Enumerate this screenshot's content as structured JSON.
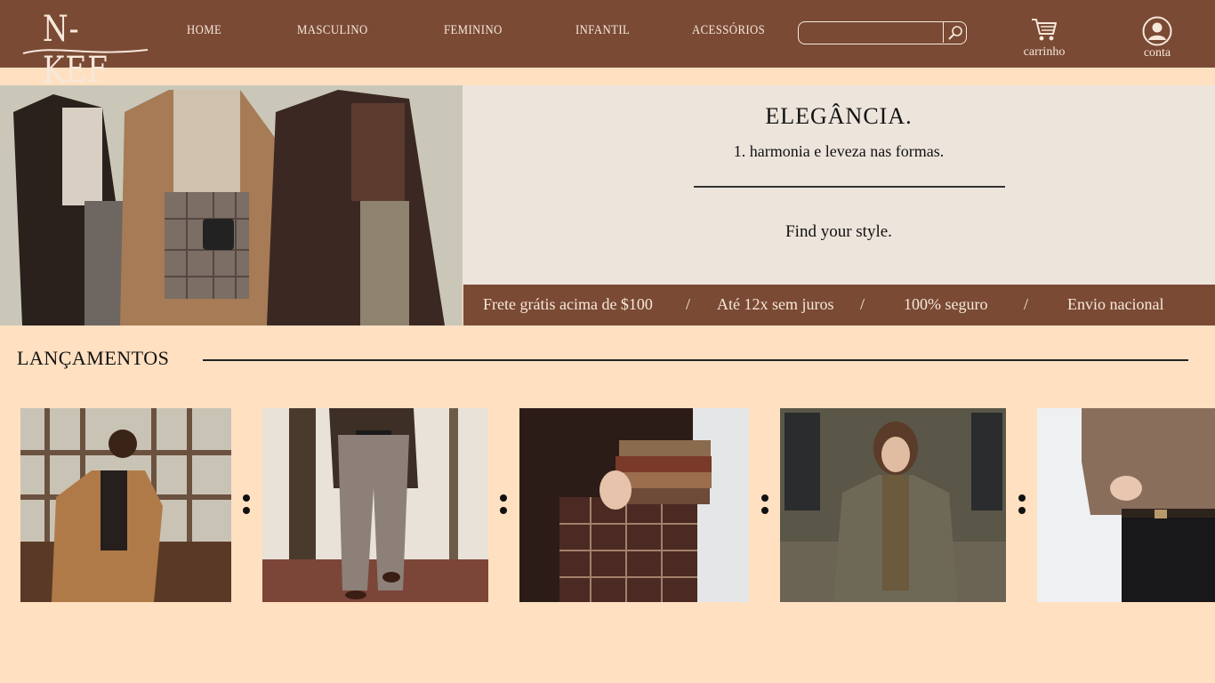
{
  "header": {
    "logo": "N-KEF",
    "nav": [
      "HOME",
      "MASCULINO",
      "FEMININO",
      "INFANTIL",
      "ACESSÓRIOS"
    ],
    "search": {
      "placeholder": "",
      "value": ""
    },
    "cart_label": "carrinho",
    "account_label": "conta"
  },
  "hero": {
    "title": "ELEGÂNCIA.",
    "subtitle": "1. harmonia e leveza nas formas.",
    "cta": "Find your style."
  },
  "benefits": {
    "items": [
      "Frete grátis acima de $100",
      "Até 12x sem juros",
      "100% seguro",
      "Envio nacional"
    ],
    "separator": "/"
  },
  "releases": {
    "title": "LANÇAMENTOS"
  },
  "colors": {
    "header_bg": "#7A4A35",
    "page_bg": "#FFE0C1",
    "panel_bg": "#EDE4DC",
    "text_light": "#F6E8DA"
  },
  "icons": [
    "search-icon",
    "cart-icon",
    "account-icon"
  ]
}
